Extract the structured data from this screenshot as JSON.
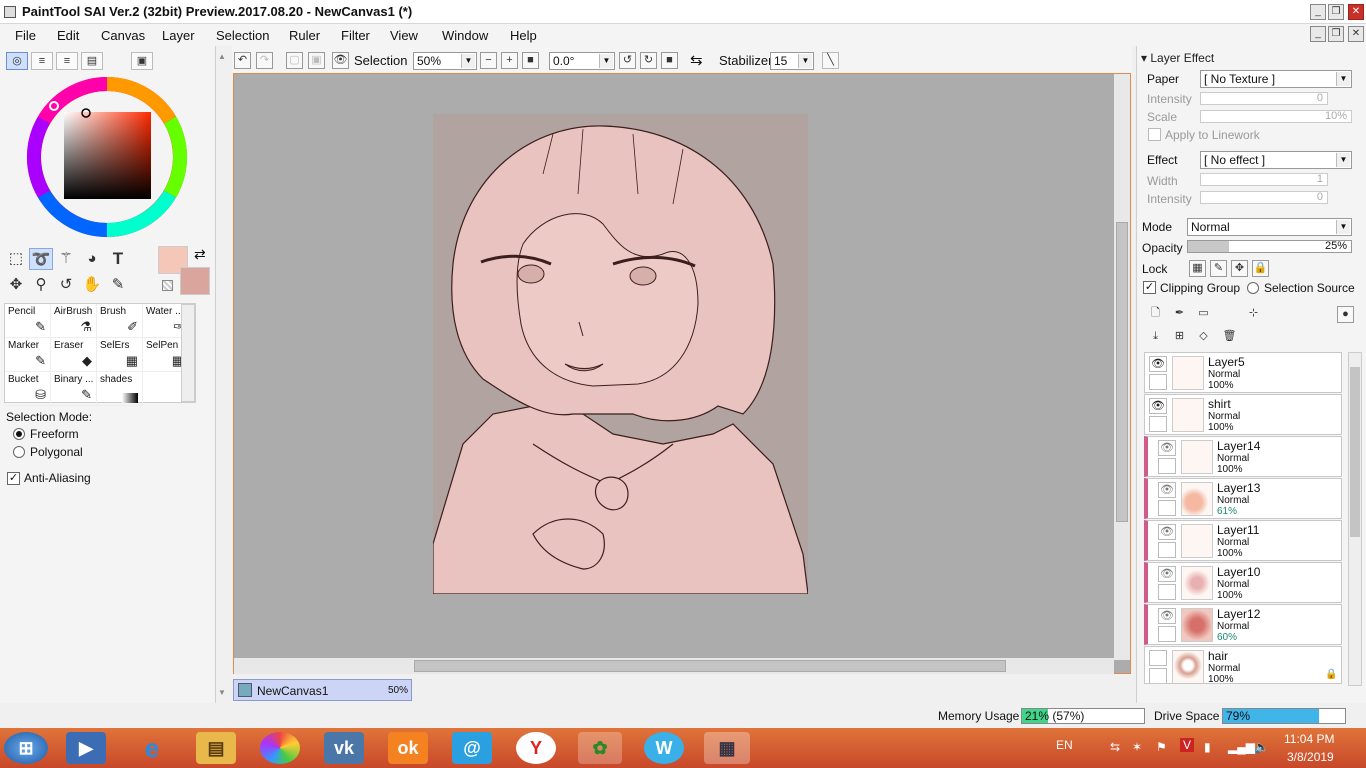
{
  "window": {
    "title": "PaintTool SAI Ver.2 (32bit) Preview.2017.08.20 - NewCanvas1 (*)"
  },
  "menu": [
    "File",
    "Edit",
    "Canvas",
    "Layer",
    "Selection",
    "Ruler",
    "Filter",
    "View",
    "Window",
    "Help"
  ],
  "colors": {
    "accent": "#e08a50",
    "primary_color": "#f5c7b8",
    "secondary_color": "#d9a59c",
    "canvas_bg": "#acacac",
    "clip_marker": "#d05a8a",
    "memory_fill": "#3fd68a",
    "drive_fill": "#3fb5ea",
    "taskbar": "#d45a30"
  },
  "tools": {
    "select_tools": [
      "rect-select-icon",
      "lasso-icon",
      "magic-wand-icon",
      "fill-shape-icon",
      "text-icon"
    ],
    "nav_tools": [
      "move-icon",
      "zoom-icon",
      "rotate-icon",
      "hand-icon",
      "eyedropper-icon"
    ],
    "text_tool": "T"
  },
  "brushes": [
    {
      "label": "Pencil",
      "icon": "pencil-icon"
    },
    {
      "label": "AirBrush",
      "icon": "airbrush-icon"
    },
    {
      "label": "Brush",
      "icon": "brush-icon"
    },
    {
      "label": "Water ...",
      "icon": "water-icon"
    },
    {
      "label": "Marker",
      "icon": "marker-icon"
    },
    {
      "label": "Eraser",
      "icon": "eraser-icon"
    },
    {
      "label": "SelErs",
      "icon": "selers-icon"
    },
    {
      "label": "SelPen",
      "icon": "selpen-icon"
    },
    {
      "label": "Bucket",
      "icon": "bucket-icon"
    },
    {
      "label": "Binary ...",
      "icon": "binary-icon"
    },
    {
      "label": "shades",
      "icon": "shades-icon"
    }
  ],
  "selection_mode": {
    "label": "Selection Mode:",
    "options": [
      "Freeform",
      "Polygonal"
    ],
    "selected": "Freeform"
  },
  "anti_aliasing": {
    "label": "Anti-Aliasing",
    "checked": true
  },
  "toolbar": {
    "selection_label": "Selection",
    "zoom": "50%",
    "angle": "0.0°",
    "stabilizer_label": "Stabilizer",
    "stabilizer_value": "15"
  },
  "document_tab": {
    "name": "NewCanvas1",
    "zoom": "50%"
  },
  "layer_effect": {
    "header": "Layer Effect",
    "paper_label": "Paper",
    "paper_value": "[ No Texture ]",
    "intensity_label": "Intensity",
    "intensity_value": "0",
    "scale_label": "Scale",
    "scale_value": "10%",
    "apply_linework": "Apply to Linework",
    "effect_label": "Effect",
    "effect_value": "[ No effect ]",
    "width_label": "Width",
    "width_value": "1",
    "intensity2_label": "Intensity",
    "intensity2_value": "0"
  },
  "layer_props": {
    "mode_label": "Mode",
    "mode_value": "Normal",
    "opacity_label": "Opacity",
    "opacity_value": "25%",
    "opacity_fraction": 0.25,
    "lock_label": "Lock",
    "clipping_label": "Clipping Group",
    "selection_source_label": "Selection Source"
  },
  "layers": [
    {
      "name": "Layer5",
      "mode": "Normal",
      "opacity": "100%",
      "visible": true,
      "clipped": false
    },
    {
      "name": "shirt",
      "mode": "Normal",
      "opacity": "100%",
      "visible": true,
      "clipped": false
    },
    {
      "name": "Layer14",
      "mode": "Normal",
      "opacity": "100%",
      "visible": true,
      "clipped": true
    },
    {
      "name": "Layer13",
      "mode": "Normal",
      "opacity": "61%",
      "visible": true,
      "clipped": true
    },
    {
      "name": "Layer11",
      "mode": "Normal",
      "opacity": "100%",
      "visible": true,
      "clipped": true
    },
    {
      "name": "Layer10",
      "mode": "Normal",
      "opacity": "100%",
      "visible": true,
      "clipped": true
    },
    {
      "name": "Layer12",
      "mode": "Normal",
      "opacity": "60%",
      "visible": true,
      "clipped": true
    },
    {
      "name": "hair",
      "mode": "Normal",
      "opacity": "100%",
      "visible": false,
      "clipped": false
    }
  ],
  "status": {
    "memory_label": "Memory Usage",
    "memory_value": "21% (57%)",
    "memory_fraction": 0.21,
    "drive_label": "Drive Space",
    "drive_value": "79%",
    "drive_fraction": 0.79
  },
  "taskbar": {
    "apps": [
      "windows-start-icon",
      "media-player-icon",
      "internet-explorer-icon",
      "file-explorer-icon",
      "color-app-icon",
      "vk-icon",
      "odnoklassniki-icon",
      "mail-icon",
      "yandex-icon",
      "feather-app-icon",
      "w-app-icon",
      "sai-taskbar-icon"
    ],
    "language": "EN",
    "time": "11:04 PM",
    "date": "3/8/2019"
  }
}
